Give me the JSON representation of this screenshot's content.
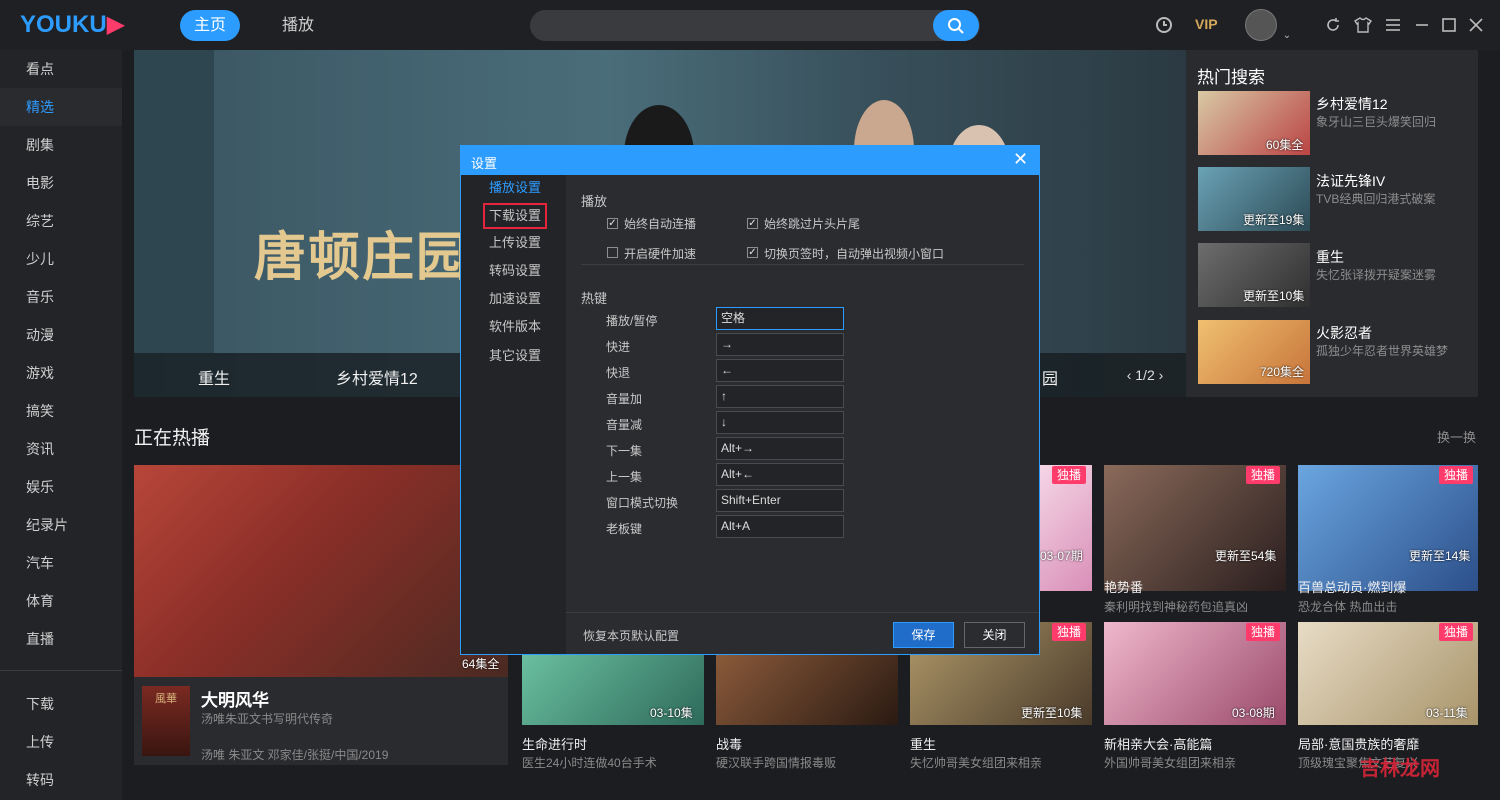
{
  "app": {
    "logo": "YOUKU",
    "logo_mark": "▶"
  },
  "nav": {
    "home": "主页",
    "play": "播放",
    "vip": "VIP"
  },
  "sidebar": {
    "items": [
      {
        "label": "看点"
      },
      {
        "label": "精选"
      },
      {
        "label": "剧集"
      },
      {
        "label": "电影"
      },
      {
        "label": "综艺"
      },
      {
        "label": "少儿"
      },
      {
        "label": "音乐"
      },
      {
        "label": "动漫"
      },
      {
        "label": "游戏"
      },
      {
        "label": "搞笑"
      },
      {
        "label": "资讯"
      },
      {
        "label": "娱乐"
      },
      {
        "label": "纪录片"
      },
      {
        "label": "汽车"
      },
      {
        "label": "体育"
      },
      {
        "label": "直播"
      },
      {
        "label": "下载"
      },
      {
        "label": "上传"
      },
      {
        "label": "转码"
      }
    ]
  },
  "banner": {
    "title": "唐顿庄园",
    "strip": [
      "重生",
      "乡村爱情12",
      "园"
    ],
    "pager": "1/2",
    "pager_prev": "‹",
    "pager_next": "›"
  },
  "hot_search": {
    "title": "热门搜索",
    "items": [
      {
        "name": "乡村爱情12",
        "desc": "象牙山三巨头爆笑回归",
        "badge": "60集全",
        "color": "#b44"
      },
      {
        "name": "法证先锋IV",
        "desc": "TVB经典回归港式破案",
        "badge": "更新至19集",
        "color": "#3b6a7a"
      },
      {
        "name": "重生",
        "desc": "失忆张译拨开疑案迷雾",
        "badge": "更新至10集",
        "color": "#4a4a4a"
      },
      {
        "name": "火影忍者",
        "desc": "孤独少年忍者世界英雄梦",
        "badge": "720集全",
        "color": "#c7743a"
      }
    ]
  },
  "section": {
    "title": "正在热播",
    "more": "换一换",
    "featured": {
      "title": "大明风华",
      "sub": "汤唯朱亚文书写明代传奇",
      "cast": "汤唯 朱亚文 邓家佳/张挺/中国/2019",
      "badge": "64集全",
      "poster_text": "風華"
    },
    "cards_top": [
      {
        "title": "",
        "desc": "",
        "badge": "03-07期",
        "dubo": "独播",
        "color": "#d98fb8"
      },
      {
        "title": "艳势番",
        "desc": "秦利明找到神秘药包追真凶",
        "badge": "更新至54集",
        "dubo": "独播",
        "color": "#6a4a4a"
      },
      {
        "title": "百兽总动员·燃到爆",
        "desc": "恐龙合体 热血出击",
        "badge": "更新至14集",
        "dubo": "独播",
        "color": "#3a6fb0"
      }
    ],
    "cards_bottom": [
      {
        "title": "生命进行时",
        "desc": "医生24小时连做40台手术",
        "badge": "03-10集",
        "dubo": "",
        "color": "#3f8f7a"
      },
      {
        "title": "战毒",
        "desc": "硬汉联手跨国情报毒贩",
        "badge": "",
        "dubo": "",
        "color": "#6b4a32"
      },
      {
        "title": "重生",
        "desc": "失忆帅哥美女组团来相亲",
        "badge": "更新至10集",
        "dubo": "独播",
        "color": "#7a6a4a"
      },
      {
        "title": "新相亲大会·高能篇",
        "desc": "外国帅哥美女组团来相亲",
        "badge": "03-08期",
        "dubo": "独播",
        "color": "#b06a8a"
      },
      {
        "title": "局部·意国贵族的奢靡",
        "desc": "顶级瑰宝聚焦文艺复兴",
        "badge": "03-11集",
        "dubo": "独播",
        "color": "#c8b89a"
      }
    ]
  },
  "settings": {
    "title": "设置",
    "close": "✕",
    "nav": [
      "播放设置",
      "下载设置",
      "上传设置",
      "转码设置",
      "加速设置",
      "软件版本",
      "其它设置"
    ],
    "play_section": "播放",
    "options": [
      {
        "label": "始终自动连播",
        "checked": true
      },
      {
        "label": "始终跳过片头片尾",
        "checked": true
      },
      {
        "label": "开启硬件加速",
        "checked": false
      },
      {
        "label": "切换页签时，自动弹出视频小窗口",
        "checked": true
      }
    ],
    "hotkey_section": "热键",
    "hotkeys": [
      {
        "label": "播放/暂停",
        "key": "空格"
      },
      {
        "label": "快进",
        "key": "→"
      },
      {
        "label": "快退",
        "key": "←"
      },
      {
        "label": "音量加",
        "key": "↑"
      },
      {
        "label": "音量减",
        "key": "↓"
      },
      {
        "label": "下一集",
        "key": "Alt+→"
      },
      {
        "label": "上一集",
        "key": "Alt+←"
      },
      {
        "label": "窗口模式切换",
        "key": "Shift+Enter"
      },
      {
        "label": "老板键",
        "key": "Alt+A"
      }
    ],
    "restore": "恢复本页默认配置",
    "save": "保存",
    "cancel": "关闭"
  },
  "watermark": "吉林龙网",
  "colors": {
    "accent": "#2d9cff",
    "brand_pink": "#ff3b6b",
    "highlight_box": "#e5253b",
    "bg": "#1c1d20"
  }
}
